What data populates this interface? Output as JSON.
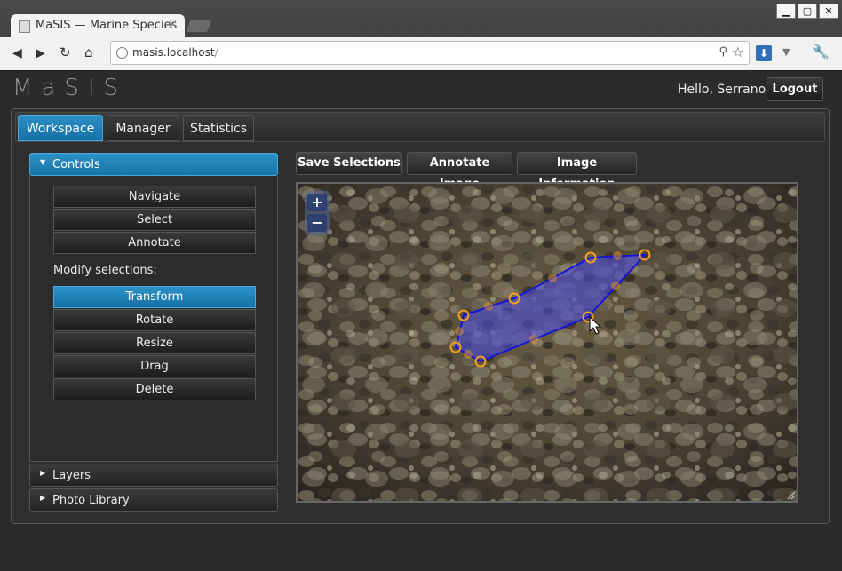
{
  "browser": {
    "tab_title": "MaSIS — Marine Species",
    "tab_close": "×",
    "url_host": "masis.localhost",
    "url_path": "/",
    "win_min": "▁",
    "win_max": "▢",
    "win_close": "✕"
  },
  "app": {
    "title": "MaSIS",
    "greeting": "Hello, Serrano",
    "logout_label": "Logout"
  },
  "nav": {
    "tabs": [
      {
        "label": "Workspace",
        "active": true
      },
      {
        "label": "Manager",
        "active": false
      },
      {
        "label": "Statistics",
        "active": false
      }
    ]
  },
  "sidebar": {
    "controls_header": "Controls",
    "mode_buttons": [
      "Navigate",
      "Select",
      "Annotate"
    ],
    "modify_label": "Modify selections:",
    "modify_buttons": [
      {
        "label": "Transform",
        "active": true
      },
      {
        "label": "Rotate",
        "active": false
      },
      {
        "label": "Resize",
        "active": false
      },
      {
        "label": "Drag",
        "active": false
      },
      {
        "label": "Delete",
        "active": false
      }
    ],
    "layers_header": "Layers",
    "library_header": "Photo Library"
  },
  "toolbar": {
    "save_label": "Save Selections",
    "annotate_label": "Annotate Image",
    "info_label": "Image Information"
  },
  "viewer": {
    "zoom_in": "+",
    "zoom_out": "−"
  },
  "colors": {
    "accent": "#1a7fbf",
    "selection_fill": "#4a4ad8",
    "selection_stroke": "#1414d6",
    "handle": "#f0a020"
  }
}
